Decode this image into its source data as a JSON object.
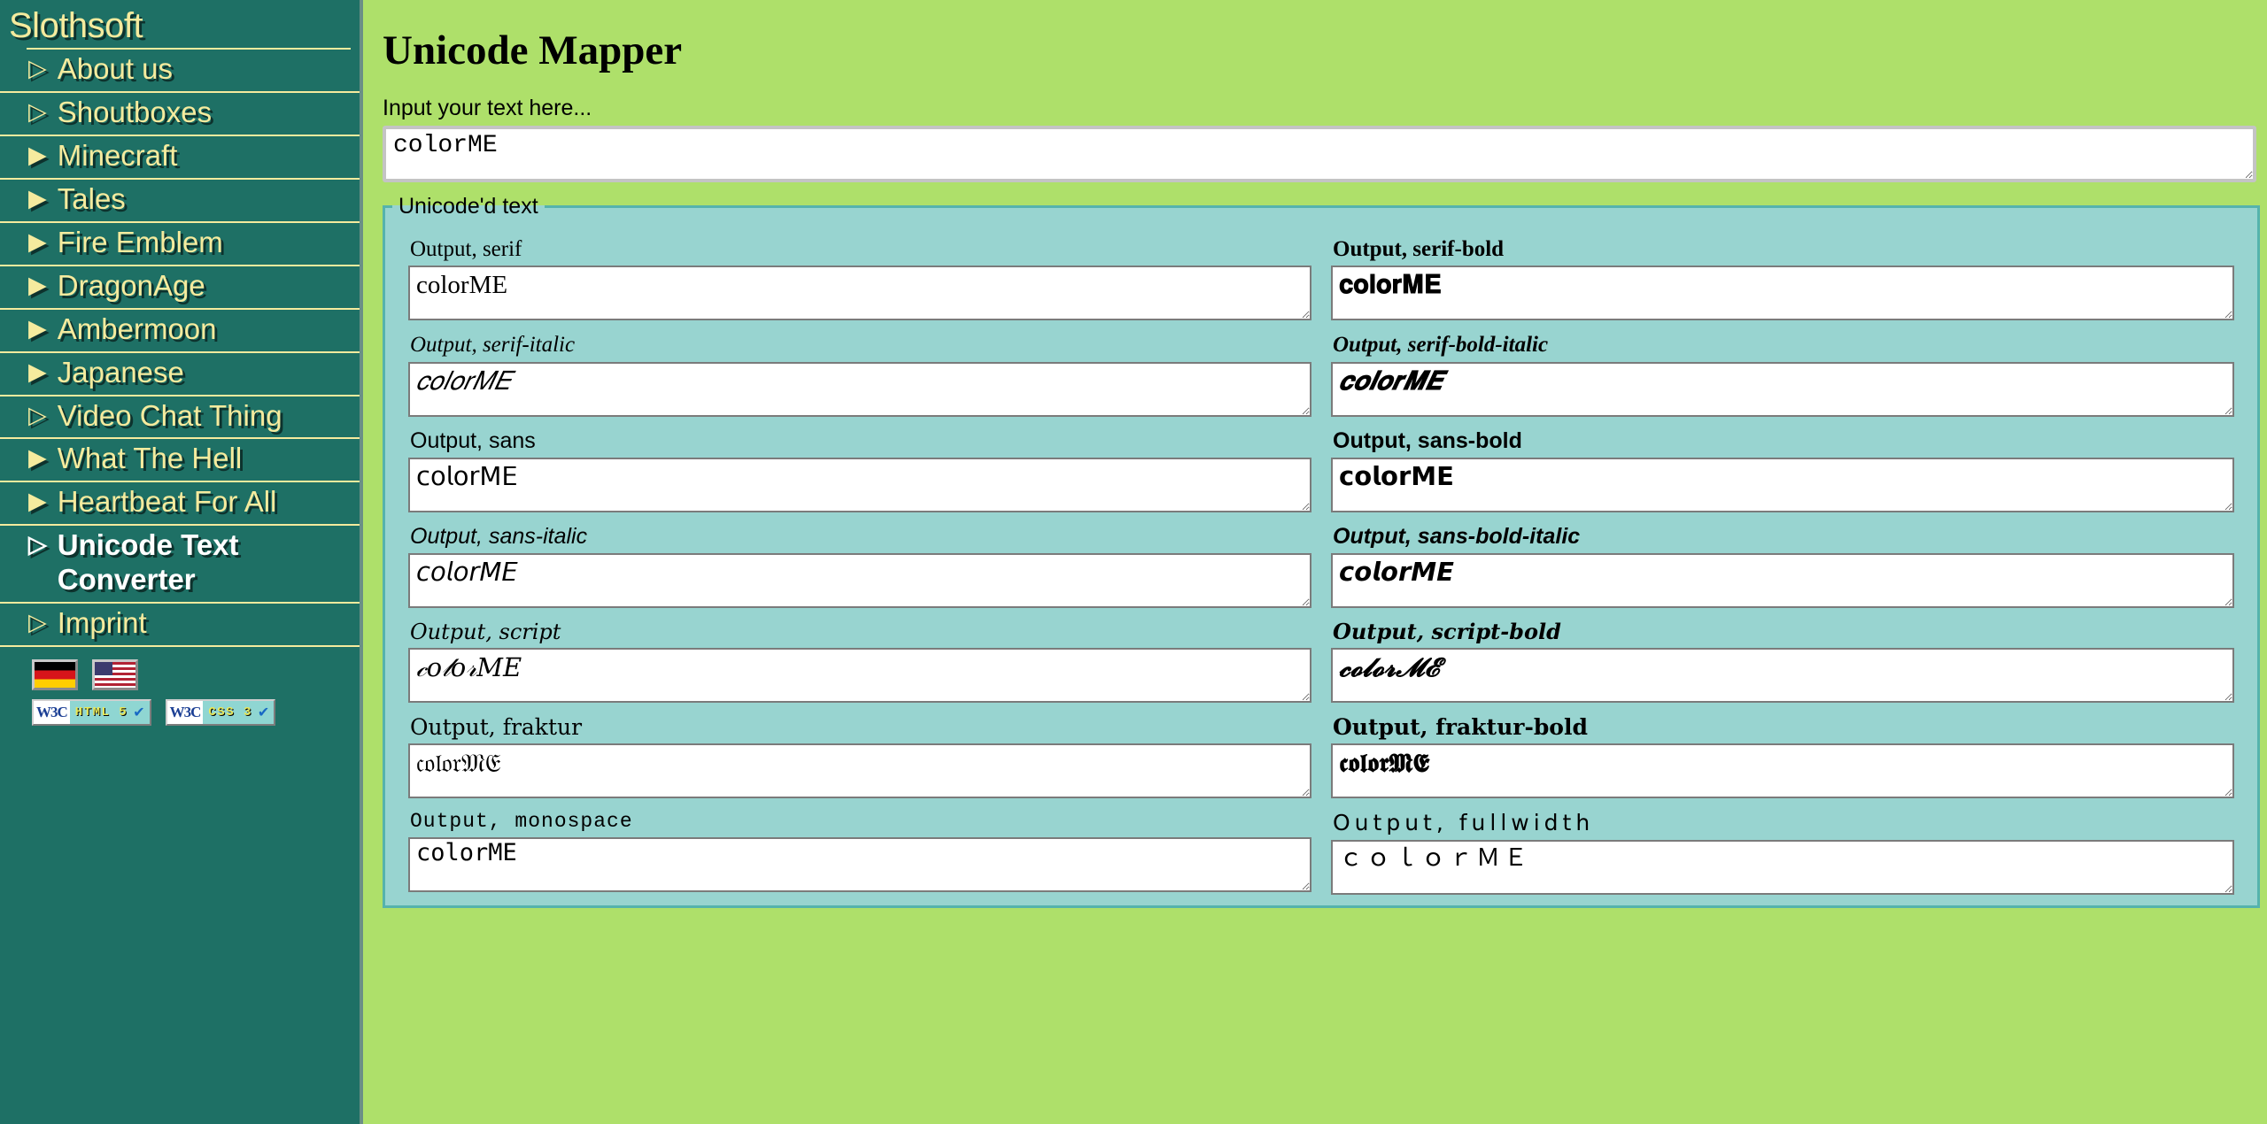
{
  "sidebar": {
    "brand": "Slothsoft",
    "items": [
      {
        "label": "About us",
        "marker": "▷",
        "current": false
      },
      {
        "label": "Shoutboxes",
        "marker": "▷",
        "current": false
      },
      {
        "label": "Minecraft",
        "marker": "▶",
        "current": false
      },
      {
        "label": "Tales",
        "marker": "▶",
        "current": false
      },
      {
        "label": "Fire Emblem",
        "marker": "▶",
        "current": false
      },
      {
        "label": "DragonAge",
        "marker": "▶",
        "current": false
      },
      {
        "label": "Ambermoon",
        "marker": "▶",
        "current": false
      },
      {
        "label": "Japanese",
        "marker": "▶",
        "current": false
      },
      {
        "label": "Video Chat Thing",
        "marker": "▷",
        "current": false
      },
      {
        "label": "What The Hell",
        "marker": "▶",
        "current": false
      },
      {
        "label": "Heartbeat For All",
        "marker": "▶",
        "current": false
      },
      {
        "label": "Unicode Text Converter",
        "marker": "▷",
        "current": true
      },
      {
        "label": "Imprint",
        "marker": "▷",
        "current": false
      }
    ],
    "flags": [
      {
        "name": "german-flag",
        "title": "Deutsch"
      },
      {
        "name": "us-flag",
        "title": "English"
      }
    ],
    "badges": [
      {
        "logo": "W3C",
        "text": "HTML 5",
        "check": "✔"
      },
      {
        "logo": "W3C",
        "text": "CSS 3",
        "check": "✔"
      }
    ]
  },
  "main": {
    "title": "Unicode Mapper",
    "input_label": "Input your text here...",
    "input_value": "colorME",
    "input_placeholder": "",
    "fieldset_legend": "Unicode'd text",
    "outputs": [
      {
        "label": "Output, serif",
        "value": "colorME",
        "variant": "v-serif"
      },
      {
        "label": "Output, serif-bold",
        "value": "𝐜𝐨𝐥𝐨𝐫𝐌𝐄",
        "variant": "v-serif-bold"
      },
      {
        "label": "Output, serif-italic",
        "value": "𝑐𝑜𝑙𝑜𝑟𝑀𝐸",
        "variant": "v-serif-italic"
      },
      {
        "label": "Output, serif-bold-italic",
        "value": "𝒄𝒐𝒍𝒐𝒓𝑴𝑬",
        "variant": "v-serif-bi"
      },
      {
        "label": "Output, sans",
        "value": "𝖼𝗈𝗅𝗈𝗋𝖬𝖤",
        "variant": "v-sans"
      },
      {
        "label": "Output, sans-bold",
        "value": "𝗰𝗼𝗹𝗼𝗿𝗠𝗘",
        "variant": "v-sans-bold"
      },
      {
        "label": "Output, sans-italic",
        "value": "𝘤𝘰𝘭𝘰𝘳𝘔𝘌",
        "variant": "v-sans-italic"
      },
      {
        "label": "Output, sans-bold-italic",
        "value": "𝙘𝙤𝙡𝙤𝙧𝙈𝙀",
        "variant": "v-sans-bi"
      },
      {
        "label": "Output, script",
        "value": "𝒸𝑜𝓁𝑜𝓇𝑀𝐸",
        "variant": "v-script"
      },
      {
        "label": "Output, script-bold",
        "value": "𝓬𝓸𝓵𝓸𝓻𝓜𝓔",
        "variant": "v-script-bold"
      },
      {
        "label": "Output, fraktur",
        "value": "𝔠𝔬𝔩𝔬𝔯𝔐𝔈",
        "variant": "v-fraktur"
      },
      {
        "label": "Output, fraktur-bold",
        "value": "𝖈𝖔𝖑𝖔𝖗𝕸𝕰",
        "variant": "v-fraktur-bold"
      },
      {
        "label": "Output, monospace",
        "value": "𝚌𝚘𝚕𝚘𝚛𝙼𝙴",
        "variant": "v-mono"
      },
      {
        "label": "Output, fullwidth",
        "value": "ｃｏｌｏｒＭＥ",
        "variant": "v-full"
      }
    ]
  },
  "colors": {
    "sidebar_bg": "#1e7065",
    "sidebar_text": "#f5eb9e",
    "sidebar_current": "#ffffff",
    "header_bg": "#aee06a",
    "fieldset_bg": "#98d4d0",
    "fieldset_border": "#55b3ad",
    "field_bg": "#ffffff",
    "field_border": "#7b7b7b"
  }
}
